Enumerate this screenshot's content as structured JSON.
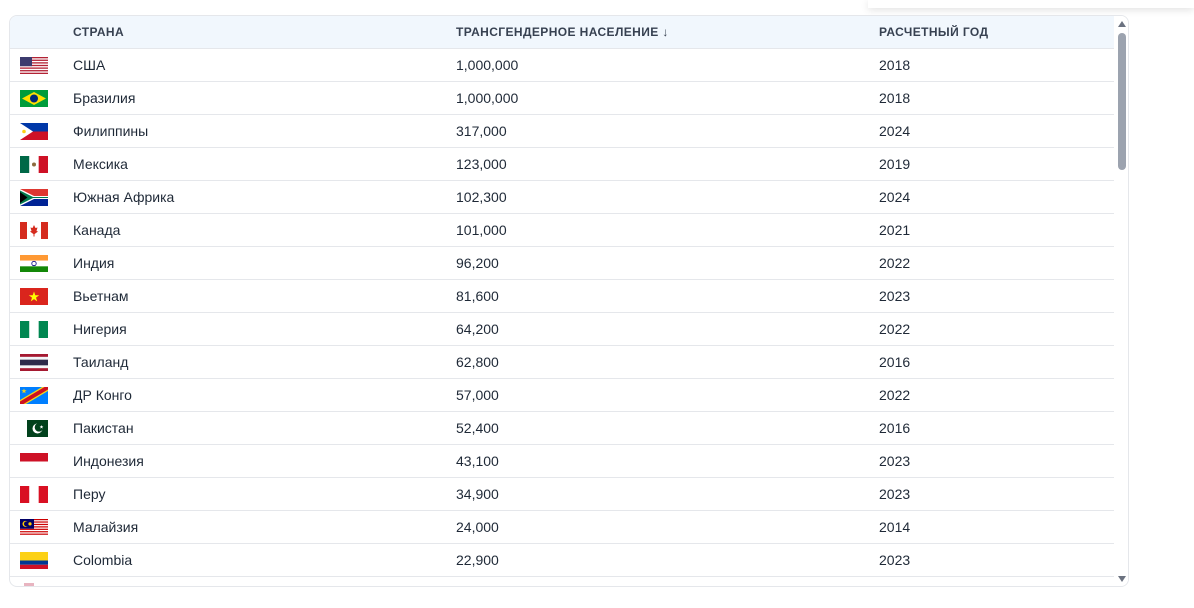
{
  "table": {
    "headers": {
      "country": "СТРАНА",
      "population": "ТРАНСГЕНДЕРНОЕ НАСЕЛЕНИЕ ↓",
      "year": "РАСЧЕТНЫЙ ГОД"
    },
    "rows": [
      {
        "flag": "usa-flag-icon",
        "country": "США",
        "population": "1,000,000",
        "year": "2018"
      },
      {
        "flag": "brazil-flag-icon",
        "country": "Бразилия",
        "population": "1,000,000",
        "year": "2018"
      },
      {
        "flag": "philippines-flag-icon",
        "country": "Филиппины",
        "population": "317,000",
        "year": "2024"
      },
      {
        "flag": "mexico-flag-icon",
        "country": "Мексика",
        "population": "123,000",
        "year": "2019"
      },
      {
        "flag": "south-africa-flag-icon",
        "country": "Южная Африка",
        "population": "102,300",
        "year": "2024"
      },
      {
        "flag": "canada-flag-icon",
        "country": "Канада",
        "population": "101,000",
        "year": "2021"
      },
      {
        "flag": "india-flag-icon",
        "country": "Индия",
        "population": "96,200",
        "year": "2022"
      },
      {
        "flag": "vietnam-flag-icon",
        "country": "Вьетнам",
        "population": "81,600",
        "year": "2023"
      },
      {
        "flag": "nigeria-flag-icon",
        "country": "Нигерия",
        "population": "64,200",
        "year": "2022"
      },
      {
        "flag": "thailand-flag-icon",
        "country": "Таиланд",
        "population": "62,800",
        "year": "2016"
      },
      {
        "flag": "dr-congo-flag-icon",
        "country": "ДР Конго",
        "population": "57,000",
        "year": "2022"
      },
      {
        "flag": "pakistan-flag-icon",
        "country": "Пакистан",
        "population": "52,400",
        "year": "2016"
      },
      {
        "flag": "indonesia-flag-icon",
        "country": "Индонезия",
        "population": "43,100",
        "year": "2023"
      },
      {
        "flag": "peru-flag-icon",
        "country": "Перу",
        "population": "34,900",
        "year": "2023"
      },
      {
        "flag": "malaysia-flag-icon",
        "country": "Малайзия",
        "population": "24,000",
        "year": "2014"
      },
      {
        "flag": "colombia-flag-icon",
        "country": "Colombia",
        "population": "22,900",
        "year": "2023"
      }
    ]
  }
}
